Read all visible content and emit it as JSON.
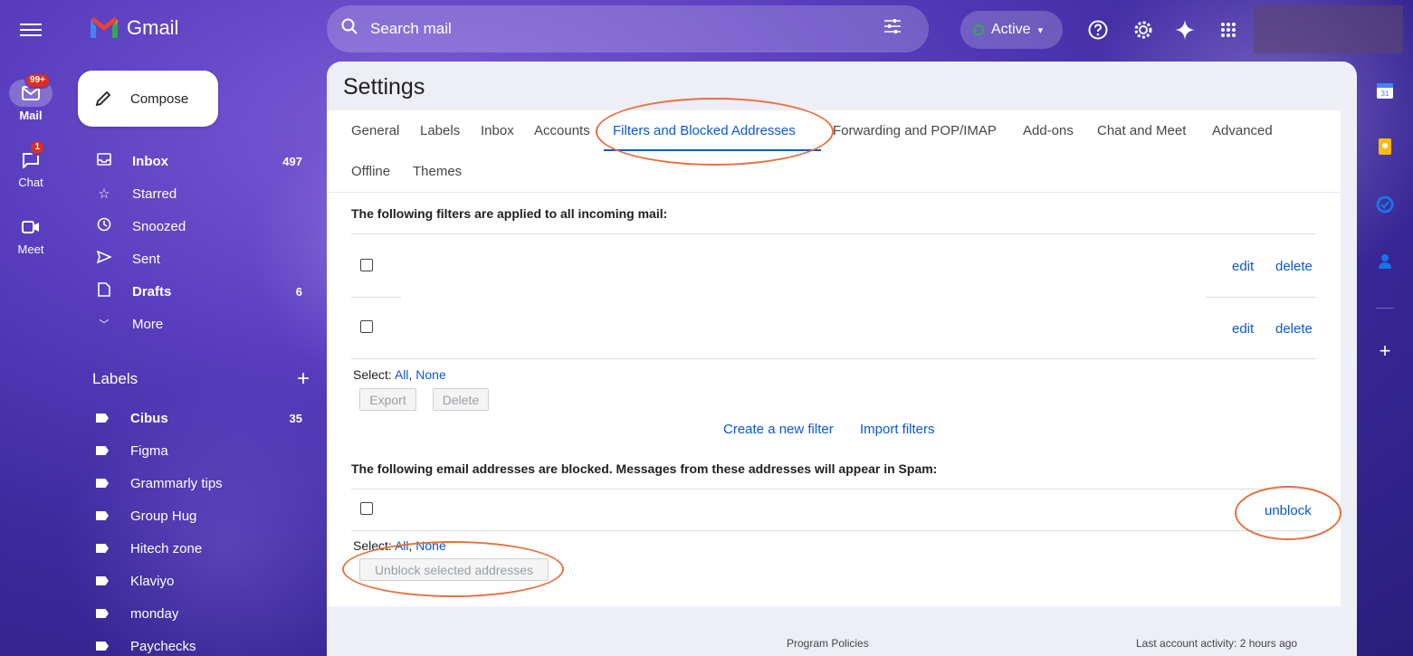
{
  "app": {
    "name": "Gmail"
  },
  "rail": {
    "items": [
      {
        "label": "Mail",
        "badge": "99+"
      },
      {
        "label": "Chat",
        "badge": "1"
      },
      {
        "label": "Meet",
        "badge": ""
      }
    ]
  },
  "compose": {
    "label": "Compose"
  },
  "nav": {
    "items": [
      {
        "label": "Inbox",
        "count": "497"
      },
      {
        "label": "Starred",
        "count": ""
      },
      {
        "label": "Snoozed",
        "count": ""
      },
      {
        "label": "Sent",
        "count": ""
      },
      {
        "label": "Drafts",
        "count": "6"
      },
      {
        "label": "More",
        "count": ""
      }
    ]
  },
  "labels": {
    "title": "Labels",
    "items": [
      {
        "label": "Cibus",
        "count": "35"
      },
      {
        "label": "Figma",
        "count": ""
      },
      {
        "label": "Grammarly tips",
        "count": ""
      },
      {
        "label": "Group Hug",
        "count": ""
      },
      {
        "label": "Hitech zone",
        "count": ""
      },
      {
        "label": "Klaviyo",
        "count": ""
      },
      {
        "label": "monday",
        "count": ""
      },
      {
        "label": "Paychecks",
        "count": ""
      }
    ]
  },
  "search": {
    "placeholder": "Search mail"
  },
  "status": {
    "label": "Active",
    "color": "#34a853"
  },
  "settings": {
    "title": "Settings",
    "tabs": [
      "General",
      "Labels",
      "Inbox",
      "Accounts",
      "Filters and Blocked Addresses",
      "Forwarding and POP/IMAP",
      "Add-ons",
      "Chat and Meet",
      "Advanced",
      "Offline",
      "Themes"
    ],
    "filters": {
      "heading": "The following filters are applied to all incoming mail:",
      "row_actions": {
        "edit": "edit",
        "delete": "delete"
      },
      "select_label": "Select:",
      "select_all": "All",
      "select_none": "None",
      "export_button": "Export",
      "delete_button": "Delete",
      "create_link": "Create a new filter",
      "import_link": "Import filters"
    },
    "blocked": {
      "heading": "The following email addresses are blocked. Messages from these addresses will appear in Spam:",
      "unblock_link": "unblock",
      "select_label": "Select:",
      "select_all": "All",
      "select_none": "None",
      "unblock_button": "Unblock selected addresses"
    }
  },
  "footer": {
    "policies": "Program Policies",
    "activity": "Last account activity: 2 hours ago"
  },
  "colors": {
    "accent": "#0b57d0",
    "annotation": "#e8703f"
  }
}
